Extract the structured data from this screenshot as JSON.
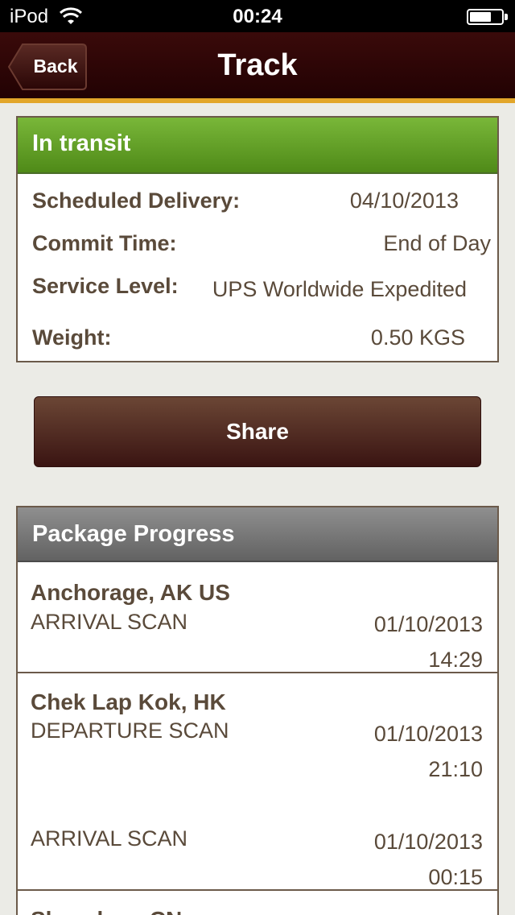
{
  "status_bar": {
    "carrier": "iPod",
    "time": "00:24"
  },
  "nav": {
    "back_label": "Back",
    "title": "Track"
  },
  "status": {
    "header": "In transit",
    "rows": [
      {
        "label": "Scheduled Delivery:",
        "value": "04/10/2013"
      },
      {
        "label": "Commit Time:",
        "value": "End of Day"
      },
      {
        "label": "Service Level:",
        "value": "UPS Worldwide Expedited"
      },
      {
        "label": "Weight:",
        "value": "0.50 KGS"
      }
    ]
  },
  "share_label": "Share",
  "progress": {
    "header": "Package Progress",
    "locations": [
      {
        "name": "Anchorage, AK US",
        "events": [
          {
            "desc": "ARRIVAL SCAN",
            "date": "01/10/2013",
            "time": "14:29"
          }
        ]
      },
      {
        "name": "Chek Lap Kok, HK",
        "events": [
          {
            "desc": "DEPARTURE SCAN",
            "date": "01/10/2013",
            "time": "21:10"
          },
          {
            "desc": "ARRIVAL SCAN",
            "date": "01/10/2013",
            "time": "00:15"
          }
        ]
      },
      {
        "name": "Shenzhen, CN",
        "events": []
      }
    ]
  },
  "colors": {
    "accent_gold": "#e2a62a",
    "nav_dark": "#220203",
    "transit_green": "#5f9b22",
    "text_brown": "#5a4a3a"
  }
}
